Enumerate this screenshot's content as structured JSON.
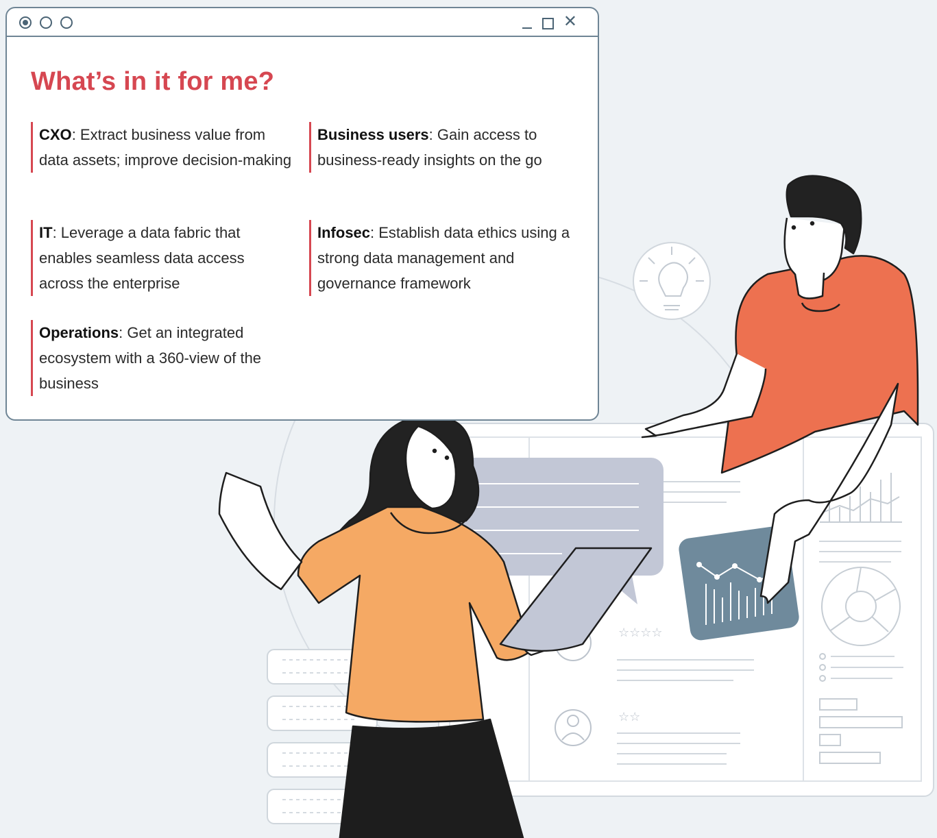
{
  "window": {
    "heading": "What’s in it for me?",
    "controls": [
      "minimize-icon",
      "maximize-icon",
      "close-icon"
    ]
  },
  "items": [
    {
      "role": "CXO",
      "text": ": Extract business value from data assets; improve decision-making"
    },
    {
      "role": "Business users",
      "text": ": Gain access to business-ready insights on the go"
    },
    {
      "role": "IT",
      "text": ": Leverage a data fabric that enables seamless data access across the enterprise"
    },
    {
      "role": "Infosec",
      "text": ": Establish data ethics using a strong data management and governance framework"
    },
    {
      "role": "Operations",
      "text": ": Get an integrated ecosystem with a 360-view of the business"
    }
  ],
  "colors": {
    "accent": "#d64751",
    "background": "#eef2f5",
    "frame": "#6f8595",
    "woman_shirt": "#f5a964",
    "man_shirt": "#ed7150",
    "panel_grey": "#c1c6d6",
    "tablet_blue": "#6f8a9c"
  }
}
